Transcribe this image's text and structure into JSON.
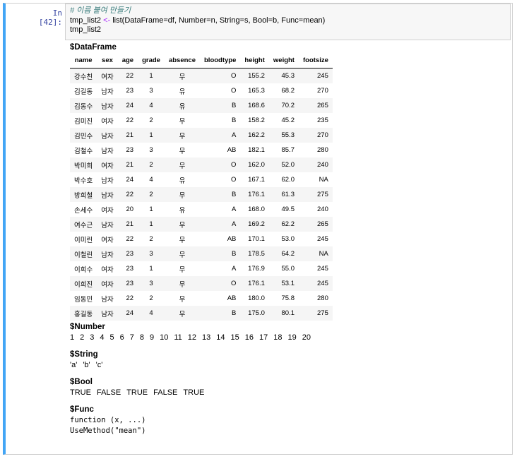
{
  "cell": {
    "prompt": "In [42]:",
    "code_lines": [
      "# 이름 붙여 만들기",
      "tmp_list2 <- list(DataFrame=df, Number=n, String=s, Bool=b, Func=mean)",
      "tmp_list2"
    ]
  },
  "output": {
    "dataframe_title": "$DataFrame",
    "columns": [
      "name",
      "sex",
      "age",
      "grade",
      "absence",
      "bloodtype",
      "height",
      "weight",
      "footsize"
    ],
    "rows": [
      [
        "강수친",
        "여자",
        "22",
        "1",
        "무",
        "O",
        "155.2",
        "45.3",
        "245"
      ],
      [
        "김길동",
        "남자",
        "23",
        "3",
        "유",
        "O",
        "165.3",
        "68.2",
        "270"
      ],
      [
        "김동수",
        "남자",
        "24",
        "4",
        "유",
        "B",
        "168.6",
        "70.2",
        "265"
      ],
      [
        "김미진",
        "여자",
        "22",
        "2",
        "무",
        "B",
        "158.2",
        "45.2",
        "235"
      ],
      [
        "김민수",
        "남자",
        "21",
        "1",
        "무",
        "A",
        "162.2",
        "55.3",
        "270"
      ],
      [
        "김철수",
        "남자",
        "23",
        "3",
        "무",
        "AB",
        "182.1",
        "85.7",
        "280"
      ],
      [
        "박미희",
        "여자",
        "21",
        "2",
        "무",
        "O",
        "162.0",
        "52.0",
        "240"
      ],
      [
        "박수호",
        "남자",
        "24",
        "4",
        "유",
        "O",
        "167.1",
        "62.0",
        "NA"
      ],
      [
        "방희철",
        "남자",
        "22",
        "2",
        "무",
        "B",
        "176.1",
        "61.3",
        "275"
      ],
      [
        "손세수",
        "여자",
        "20",
        "1",
        "유",
        "A",
        "168.0",
        "49.5",
        "240"
      ],
      [
        "여수근",
        "남자",
        "21",
        "1",
        "무",
        "A",
        "169.2",
        "62.2",
        "265"
      ],
      [
        "이미린",
        "여자",
        "22",
        "2",
        "무",
        "AB",
        "170.1",
        "53.0",
        "245"
      ],
      [
        "이철린",
        "남자",
        "23",
        "3",
        "무",
        "B",
        "178.5",
        "64.2",
        "NA"
      ],
      [
        "이희수",
        "여자",
        "23",
        "1",
        "무",
        "A",
        "176.9",
        "55.0",
        "245"
      ],
      [
        "이희진",
        "여자",
        "23",
        "3",
        "무",
        "O",
        "176.1",
        "53.1",
        "245"
      ],
      [
        "임동민",
        "남자",
        "22",
        "2",
        "무",
        "AB",
        "180.0",
        "75.8",
        "280"
      ],
      [
        "홍길동",
        "남자",
        "24",
        "4",
        "무",
        "B",
        "175.0",
        "80.1",
        "275"
      ]
    ],
    "number_title": "$Number",
    "numbers": [
      "1",
      "2",
      "3",
      "4",
      "5",
      "6",
      "7",
      "8",
      "9",
      "10",
      "11",
      "12",
      "13",
      "14",
      "15",
      "16",
      "17",
      "18",
      "19",
      "20"
    ],
    "string_title": "$String",
    "strings": [
      "'a'",
      "'b'",
      "'c'"
    ],
    "bool_title": "$Bool",
    "bools": [
      "TRUE",
      "FALSE",
      "TRUE",
      "FALSE",
      "TRUE"
    ],
    "func_title": "$Func",
    "func_lines": [
      "function (x, ...)",
      "UseMethod(\"mean\")"
    ]
  }
}
